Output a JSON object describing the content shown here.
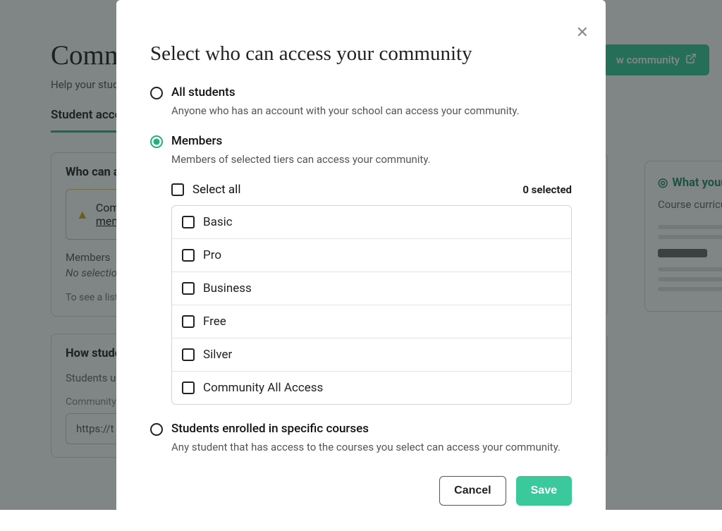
{
  "bg": {
    "title": "Community",
    "subtitle": "Help your students",
    "tab_label": "Student access",
    "card1_title": "Who can access",
    "alert_text": "Community members",
    "alert_link": "members",
    "subline1": "Members",
    "subline2": "No selection",
    "hint": "To see a list",
    "card2_title": "How students",
    "card2_para": "Students use community",
    "input_label": "Community URL",
    "input_value": "https://t",
    "right_title": "What your",
    "right_sub": "Course curriculum",
    "preview_btn": "w community"
  },
  "modal": {
    "title": "Select who can access your community",
    "options": {
      "all": {
        "label": "All students",
        "desc": "Anyone who has an account with your school can access your community."
      },
      "members": {
        "label": "Members",
        "desc": "Members of selected tiers can access your community."
      },
      "courses": {
        "label": "Students enrolled in specific courses",
        "desc": "Any student that has access to the courses you select can access your community."
      }
    },
    "select_all_label": "Select all",
    "selected_count": "0 selected",
    "tiers": [
      "Basic",
      "Pro",
      "Business",
      "Free",
      "Silver",
      "Community All Access"
    ],
    "cancel_label": "Cancel",
    "save_label": "Save"
  }
}
